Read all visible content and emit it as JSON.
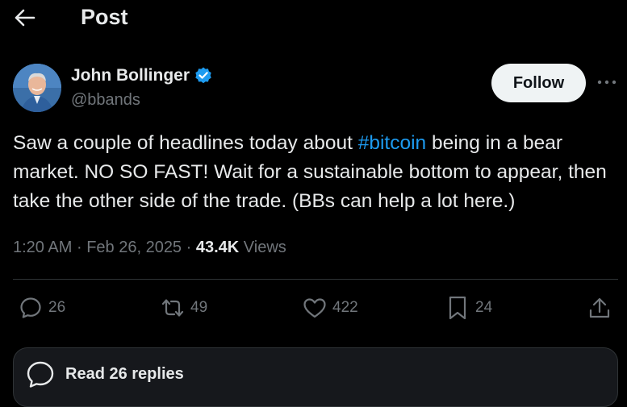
{
  "header": {
    "title": "Post"
  },
  "author": {
    "name": "John Bollinger",
    "handle": "@bbands",
    "verified": true
  },
  "follow_button": {
    "label": "Follow"
  },
  "tweet": {
    "text_before": "Saw a couple of headlines today about ",
    "hashtag": "#bitcoin",
    "text_after": " being in a bear market. NO SO FAST! Wait for a sustainable bottom to appear, then take the other side of the trade. (BBs can help a lot here.)"
  },
  "meta": {
    "time": "1:20 AM",
    "separator": "·",
    "date": "Feb 26, 2025",
    "views_count": "43.4K",
    "views_label": "Views"
  },
  "actions": {
    "replies": {
      "icon": "reply-icon",
      "count": "26"
    },
    "reposts": {
      "icon": "repost-icon",
      "count": "49"
    },
    "likes": {
      "icon": "like-icon",
      "count": "422"
    },
    "bookmarks": {
      "icon": "bookmark-icon",
      "count": "24"
    },
    "share": {
      "icon": "share-icon"
    }
  },
  "read_replies": {
    "label": "Read 26 replies",
    "icon": "reply-bubble-icon"
  },
  "colors": {
    "background": "#000000",
    "text": "#e7e9ea",
    "secondary": "#71767b",
    "accent": "#1d9bf0",
    "border": "#2f3336"
  }
}
